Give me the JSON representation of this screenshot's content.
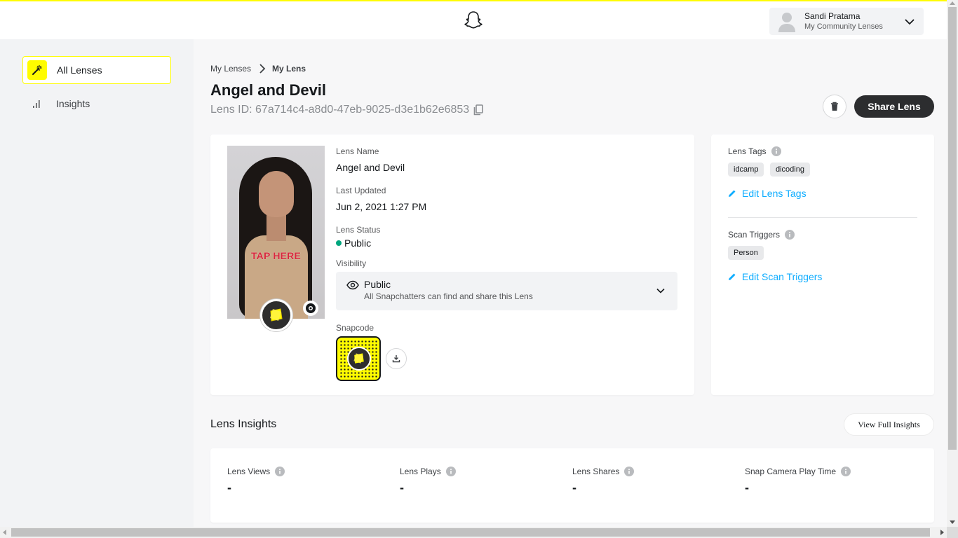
{
  "header": {
    "user_name": "Sandi Pratama",
    "user_subtitle": "My Community Lenses",
    "icons": [
      "snapchat-ghost-icon",
      "avatar-icon",
      "chevron-down-icon"
    ]
  },
  "sidebar": {
    "items": [
      {
        "label": "All Lenses",
        "icon": "magic-wand-icon",
        "active": true
      },
      {
        "label": "Insights",
        "icon": "bar-chart-icon",
        "active": false
      }
    ]
  },
  "breadcrumb": {
    "parent": "My Lenses",
    "current": "My Lens"
  },
  "page": {
    "title": "Angel and Devil",
    "lens_id": "Lens ID: 67a714c4-a8d0-47eb-9025-d3e1b62e6853"
  },
  "actions": {
    "share_label": "Share Lens"
  },
  "lens_details": {
    "preview_overlay_text": "TAP HERE",
    "name_label": "Lens Name",
    "name_value": "Angel and Devil",
    "updated_label": "Last Updated",
    "updated_value": "Jun 2, 2021 1:27 PM",
    "status_label": "Lens Status",
    "status_value": "Public",
    "visibility_label": "Visibility",
    "visibility_value": "Public",
    "visibility_description": "All Snapchatters can find and share this Lens",
    "snapcode_label": "Snapcode"
  },
  "tags": {
    "lens_tags_label": "Lens Tags",
    "lens_tags": [
      "idcamp",
      "dicoding"
    ],
    "edit_lens_tags": "Edit Lens Tags",
    "scan_triggers_label": "Scan Triggers",
    "scan_triggers": [
      "Person"
    ],
    "edit_scan_triggers": "Edit Scan Triggers"
  },
  "insights": {
    "title": "Lens Insights",
    "view_full_label": "View Full Insights",
    "metrics": [
      {
        "label": "Lens Views",
        "value": "-"
      },
      {
        "label": "Lens Plays",
        "value": "-"
      },
      {
        "label": "Lens Shares",
        "value": "-"
      },
      {
        "label": "Snap Camera Play Time",
        "value": "-"
      }
    ]
  },
  "colors": {
    "brand_yellow": "#fffc00",
    "status_green": "#00a67e",
    "link_blue": "#0fadff",
    "dark_button": "#2c2d2f"
  }
}
